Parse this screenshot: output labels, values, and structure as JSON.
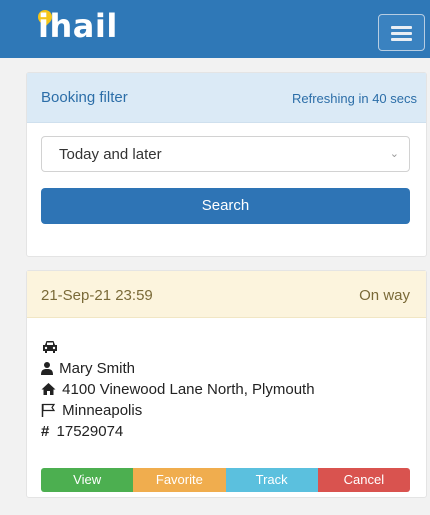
{
  "header": {
    "logo_text": "ihail",
    "menu_icon": "hamburger-icon",
    "brand_color": "#2f78b7"
  },
  "filter": {
    "title": "Booking filter",
    "refresh_text": "Refreshing in 40 secs",
    "select_value": "Today and later",
    "search_label": "Search"
  },
  "booking": {
    "datetime": "21-Sep-21 23:59",
    "status": "On way",
    "vehicle_icon": "taxi-icon",
    "passenger": "Mary Smith",
    "pickup": "4100 Vinewood Lane North, Plymouth",
    "destination": "Minneapolis",
    "number": "17529074",
    "actions": {
      "view": "View",
      "favorite": "Favorite",
      "track": "Track",
      "cancel": "Cancel"
    }
  }
}
